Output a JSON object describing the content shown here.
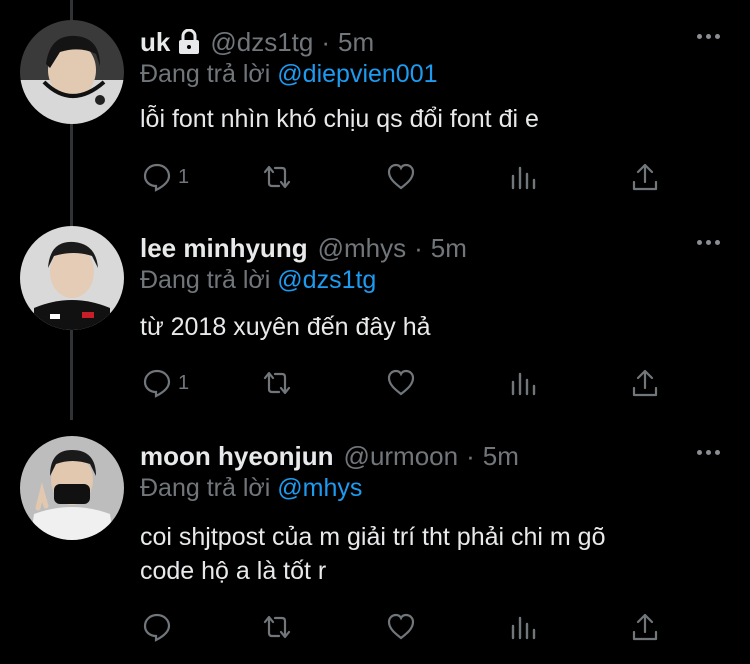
{
  "tweets": [
    {
      "display_name": "uk",
      "locked": true,
      "handle": "@dzs1tg",
      "time": "5m",
      "replying_label": "Đang trả lời",
      "replying_to": "@diepvien001",
      "text": "lỗi font nhìn khó chịu qs đổi font đi e",
      "reply_count": "1"
    },
    {
      "display_name": "lee minhyung",
      "locked": false,
      "handle": "@mhys",
      "time": "5m",
      "replying_label": "Đang trả lời",
      "replying_to": "@dzs1tg",
      "text": "từ 2018 xuyên đến đây hả",
      "reply_count": "1"
    },
    {
      "display_name": "moon hyeonjun",
      "locked": false,
      "handle": "@urmoon",
      "time": "5m",
      "replying_label": "Đang trả lời",
      "replying_to": "@mhys",
      "text_line1": "coi shjtpost của m giải trí tht phải chi m gõ",
      "text_line2": "code hộ a là tốt r",
      "reply_count": ""
    }
  ],
  "separator": "·",
  "colors": {
    "background": "#000000",
    "text": "#e7e9ea",
    "muted": "#71767b",
    "link": "#1d9bf0"
  }
}
